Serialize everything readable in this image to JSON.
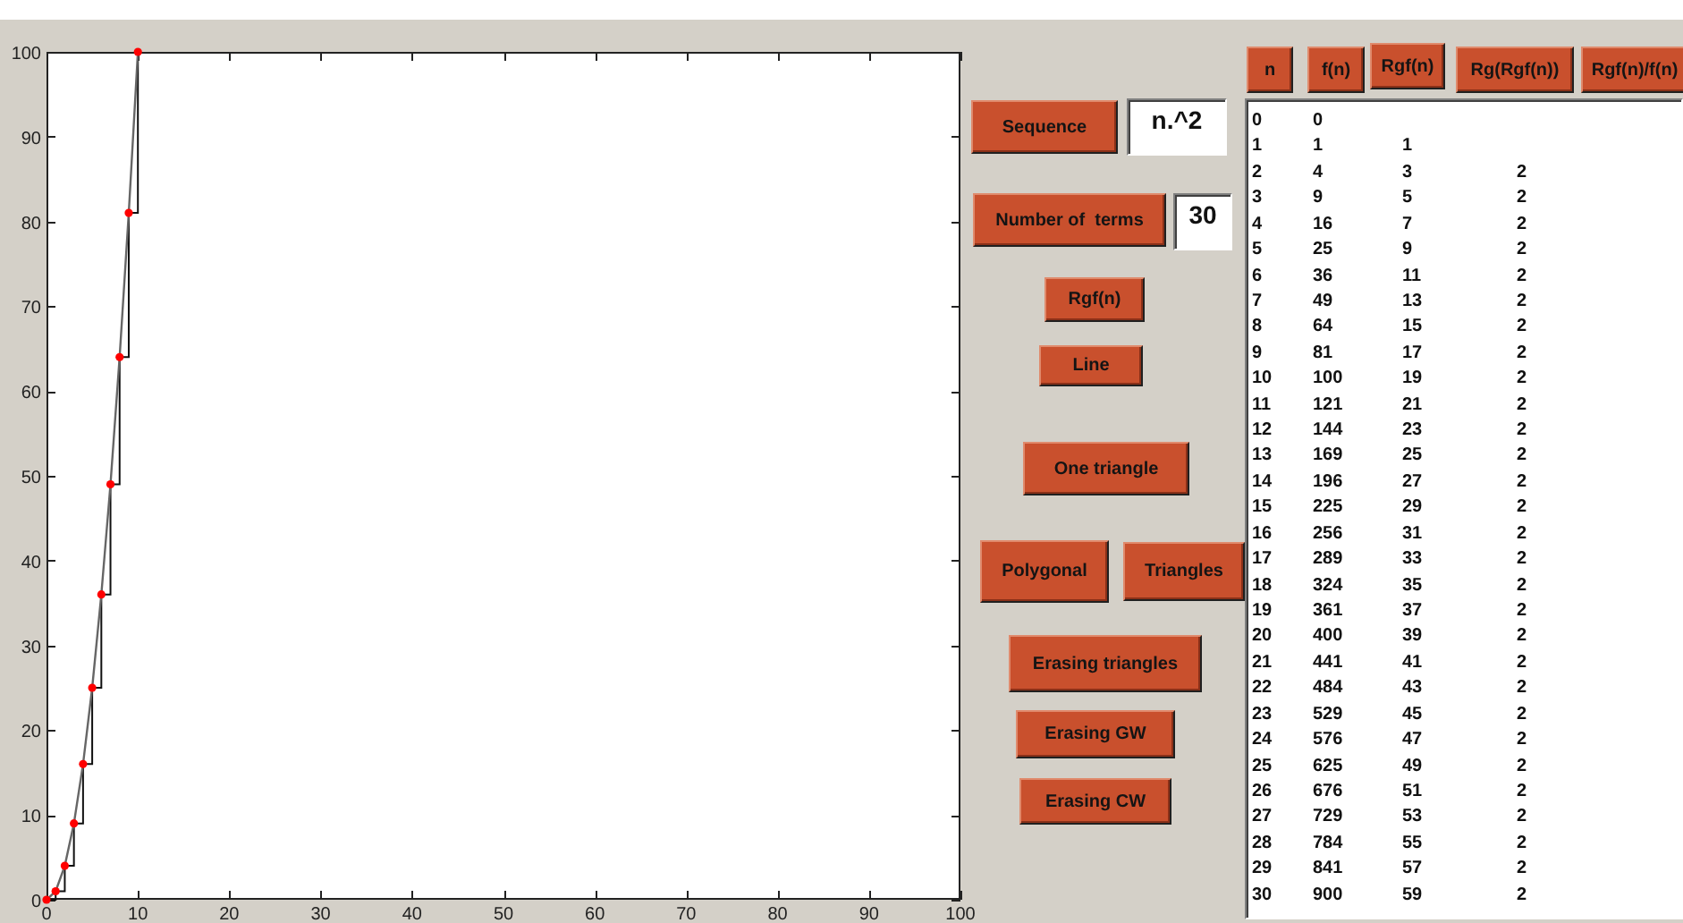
{
  "plot": {
    "chart_data": {
      "type": "line",
      "x": [
        0,
        1,
        2,
        3,
        4,
        5,
        6,
        7,
        8,
        9,
        10
      ],
      "series": [
        {
          "color": "#ff0000",
          "marker": "o",
          "values": [
            0,
            1,
            4,
            9,
            16,
            25,
            36,
            49,
            64,
            81,
            100
          ]
        }
      ],
      "xlim": [
        0,
        100
      ],
      "ylim": [
        0,
        100
      ],
      "xticks": [
        0,
        10,
        20,
        30,
        40,
        50,
        60,
        70,
        80,
        90,
        100
      ],
      "yticks": [
        0,
        10,
        20,
        30,
        40,
        50,
        60,
        70,
        80,
        90,
        100
      ]
    }
  },
  "controls": {
    "rows": [
      [
        {
          "kind": "button",
          "label": "Sequence"
        },
        {
          "kind": "field",
          "value": "n.^2"
        }
      ],
      [
        {
          "kind": "button",
          "label": "Number of  terms"
        },
        {
          "kind": "field",
          "value": "30"
        }
      ],
      [
        {
          "kind": "button",
          "label": "Rgf(n)"
        }
      ],
      [
        {
          "kind": "button",
          "label": "Line"
        }
      ],
      [
        {
          "kind": "button",
          "label": "One triangle"
        }
      ],
      [
        {
          "kind": "button",
          "label": "Polygonal"
        },
        {
          "kind": "button",
          "label": "Triangles"
        }
      ],
      [
        {
          "kind": "button",
          "label": "Erasing triangles"
        }
      ],
      [
        {
          "kind": "button",
          "label": "Erasing GW"
        }
      ],
      [
        {
          "kind": "button",
          "label": "Erasing CW"
        }
      ]
    ]
  },
  "table": {
    "columns": [
      "n",
      "f(n)",
      "Rgf(n)",
      "Rg(Rgf(n))",
      "Rgf(n)/f(n)"
    ],
    "rows": [
      [
        "0",
        "0"
      ],
      [
        "1",
        "1",
        "1"
      ],
      [
        "2",
        "4",
        "3",
        "2"
      ],
      [
        "3",
        "9",
        "5",
        "2"
      ],
      [
        "4",
        "16",
        "7",
        "2"
      ],
      [
        "5",
        "25",
        "9",
        "2"
      ],
      [
        "6",
        "36",
        "11",
        "2"
      ],
      [
        "7",
        "49",
        "13",
        "2"
      ],
      [
        "8",
        "64",
        "15",
        "2"
      ],
      [
        "9",
        "81",
        "17",
        "2"
      ],
      [
        "10",
        "100",
        "19",
        "2"
      ],
      [
        "11",
        "121",
        "21",
        "2"
      ],
      [
        "12",
        "144",
        "23",
        "2"
      ],
      [
        "13",
        "169",
        "25",
        "2"
      ],
      [
        "14",
        "196",
        "27",
        "2"
      ],
      [
        "15",
        "225",
        "29",
        "2"
      ],
      [
        "16",
        "256",
        "31",
        "2"
      ],
      [
        "17",
        "289",
        "33",
        "2"
      ],
      [
        "18",
        "324",
        "35",
        "2"
      ],
      [
        "19",
        "361",
        "37",
        "2"
      ],
      [
        "20",
        "400",
        "39",
        "2"
      ],
      [
        "21",
        "441",
        "41",
        "2"
      ],
      [
        "22",
        "484",
        "43",
        "2"
      ],
      [
        "23",
        "529",
        "45",
        "2"
      ],
      [
        "24",
        "576",
        "47",
        "2"
      ],
      [
        "25",
        "625",
        "49",
        "2"
      ],
      [
        "26",
        "676",
        "51",
        "2"
      ],
      [
        "27",
        "729",
        "53",
        "2"
      ],
      [
        "28",
        "784",
        "55",
        "2"
      ],
      [
        "29",
        "841",
        "57",
        "2"
      ],
      [
        "30",
        "900",
        "59",
        "2"
      ]
    ]
  }
}
